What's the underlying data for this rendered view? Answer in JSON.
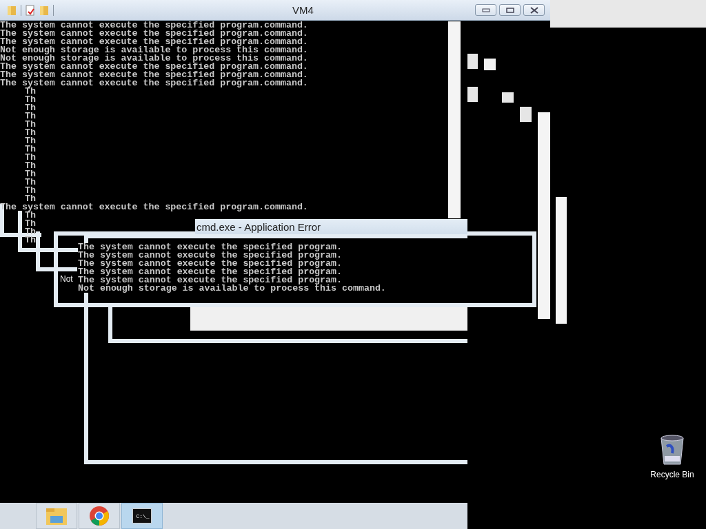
{
  "vm_window": {
    "title": "VM4"
  },
  "console": {
    "lines": [
      {
        "kind": "full",
        "text": "The system cannot execute the specified program.command."
      },
      {
        "kind": "full",
        "text": "The system cannot execute the specified program.command."
      },
      {
        "kind": "full",
        "text": "The system cannot execute the specified program.command."
      },
      {
        "kind": "full",
        "text": "Not enough storage is available to process this command."
      },
      {
        "kind": "full",
        "text": "Not enough storage is available to process this command."
      },
      {
        "kind": "full",
        "text": "The system cannot execute the specified program.command."
      },
      {
        "kind": "full",
        "text": "The system cannot execute the specified program.command."
      },
      {
        "kind": "full",
        "text": "The system cannot execute the specified program.command."
      },
      {
        "kind": "fragment",
        "text": "Th"
      },
      {
        "kind": "fragment",
        "text": "Th"
      },
      {
        "kind": "fragment",
        "text": "Th"
      },
      {
        "kind": "fragment",
        "text": "Th"
      },
      {
        "kind": "fragment",
        "text": "Th"
      },
      {
        "kind": "fragment",
        "text": "Th"
      },
      {
        "kind": "fragment",
        "text": "Th"
      },
      {
        "kind": "fragment",
        "text": "Th"
      },
      {
        "kind": "fragment",
        "text": "Th"
      },
      {
        "kind": "fragment",
        "text": "Th"
      },
      {
        "kind": "fragment",
        "text": "Th"
      },
      {
        "kind": "fragment",
        "text": "Th"
      },
      {
        "kind": "fragment",
        "text": "Th"
      },
      {
        "kind": "fragment",
        "text": "Th"
      },
      {
        "kind": "full",
        "text": "The system cannot execute the specified program.command."
      },
      {
        "kind": "fragment",
        "text": "Th"
      },
      {
        "kind": "fragment",
        "text": "Th"
      },
      {
        "kind": "fragment",
        "text": "Th"
      },
      {
        "kind": "fragment",
        "text": "Th"
      }
    ]
  },
  "error_dialog": {
    "title": "cmd.exe - Application Error",
    "fragment": "Not",
    "lines": [
      "The system cannot execute the specified program.",
      "The system cannot execute the specified program.",
      "The system cannot execute the specified program.",
      "The system cannot execute the specified program.",
      "The system cannot execute the specified program.",
      "Not enough storage is available to process this command."
    ]
  },
  "desktop_icons": [
    {
      "label": "Recycle Bin"
    }
  ],
  "taskbar": {
    "items": [
      {
        "kind": "explorer",
        "selected": false
      },
      {
        "kind": "chrome",
        "selected": false
      },
      {
        "kind": "cmd",
        "selected": true,
        "icon_text": "C:\\_"
      }
    ]
  }
}
